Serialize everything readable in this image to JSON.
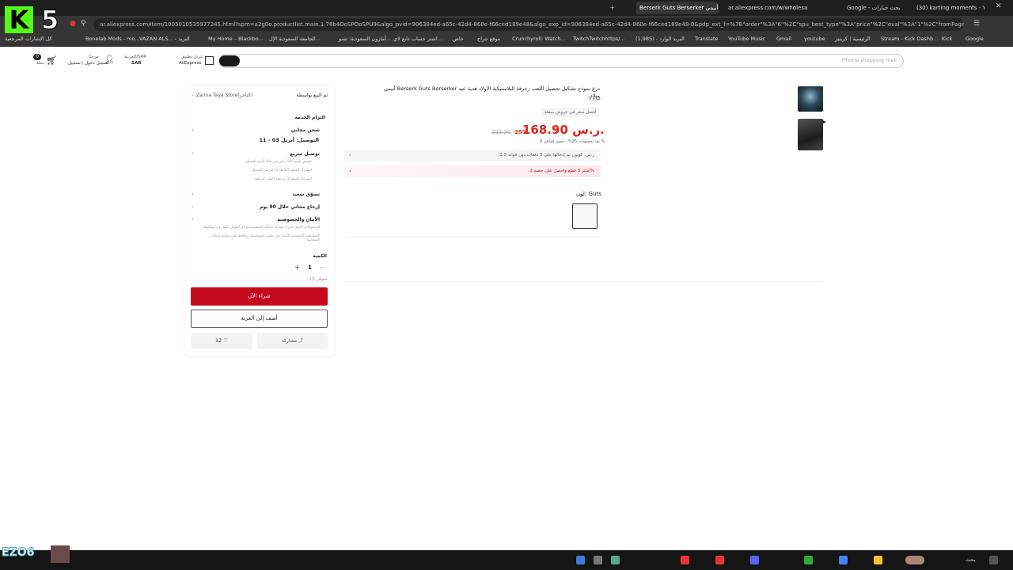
{
  "tabs": [
    {
      "label": "Berserk Guts Berserker أنيمي ...",
      "active": true
    },
    {
      "label": "ar.aliexpress.com/w/wholesale-",
      "active": false
    },
    {
      "label": "Google - بحث خيارات",
      "active": false
    },
    {
      "label": "(30) karting moments - YouTube",
      "active": false
    }
  ],
  "url": "ar.aliexpress.com/item/1005010535977245.html?spm=a2g0o.productlist.main.1.76b4OoSPOoSPU9&algo_pvid=906384ed-a65c-42d4-860e-f66ced189e48&algo_exp_id=906384ed-a65c-42d4-860e-f66ced189e48-0&pdp_ext_f=%7B\"order\"%3A\"6\"%2C\"spu_best_type\"%3A\"price\"%2C\"eval\"%3A\"1\"%2C\"fromPage\"%3A\"search\"%7D&pdp_npi=6%40",
  "bookmarks": [
    "كل الإشارات المرجعية",
    "Bonelab Mods - mo...",
    "VAZAN ALS... - البريد",
    "My Home – Blackbo...",
    "الجامعة السعودية الإل...",
    "أمازون السعودية: تسو...",
    "اشتر حساب دايغ لاي...",
    "خاص",
    "موقع جراح",
    "Crunchyroll: Watch...",
    "TwitchTwitchhttps/...",
    "(1,985) - البريد الوارد",
    "Translate",
    "YouTube Music",
    "Gmail",
    "youtube",
    "الرئيسية | كريتيز",
    "Stream - Kick Dashb...",
    "Kick",
    "Google"
  ],
  "header": {
    "cart_count": "0",
    "cart_label": "سلة",
    "account_hello": "مرحبًا",
    "account_label": "تسجيل دخول / تسجيل",
    "locale_top": "العربية/SAR",
    "locale_currency": "SAR",
    "app_label_top": "تنزيل تطبيق",
    "app_label_bottom": "AliExpress",
    "search_placeholder": "iPhone shopping mall"
  },
  "store": {
    "sold_by": "تم البيع بواسطة",
    "store_name": "Zanna Taya Store(التاجر)"
  },
  "shipping": {
    "commitment": "التزام الخدمة",
    "free_shipping": "شحن مجاني",
    "delivery": "التوصيل: أبريل 03 - 11",
    "fast_delivery": "توصيل سريع",
    "fast_line1": "تعويض قيمته 50 ر.س في حالة تأخير التسليم",
    "fast_line2": "استرداد المبلغ بالكامل إذا لم يتم التوصيل",
    "fast_line3": "استرداد المبلغ إذا تم فقد الطرد أو تلفه",
    "happy_shopping": "تسوّق سعيد",
    "free_returns": "إرجاع مجاني خلال 90 يوم",
    "security": "الأمان والخصوصية",
    "security_line1": "المدفوعات الآمنة: نحن لا نشارك بياناتك الشخصية مع أي أطراف ثالثة دون موافقتك",
    "security_line2": "المعلومات الشخصية الآمنة: نحن نحمي خصوصيتك ونحافظ على سلامة بياناتك الشخصية"
  },
  "quantity": {
    "label": "الكمية",
    "value": "1",
    "minus": "−",
    "plus": "+",
    "available": "متوفر 15"
  },
  "buttons": {
    "buy_now": "شراء الآن",
    "add_to_cart": "أضف إلى العربة",
    "share": "مشاركة",
    "wishlist_count": "12"
  },
  "product": {
    "title": "أنيمي Berserk Guts Berserker درع نموذج تشكيل تحصيل اللعب زخرفة البلاستيكية الأولاد هدية عيد ميلاد",
    "sold": "5 مُباع",
    "badge": "أفضل سعر في عروض سفلة",
    "price": "168.90 ر.س.",
    "discount": "25%",
    "old_price": "225.20",
    "tax_note": "بعد تخفيضات 25% - حسم إضافي 0 %",
    "promo1": "2.3 ر.س. كوبون تم إدخالها على 5 دفعات دون فوائد",
    "promo2": "إشتر 3 قطع واحصل على خصم 2%",
    "color_label": "لون: Guts"
  },
  "thumbnails": [
    "thumb-1",
    "thumb-2"
  ],
  "stream": {
    "logo_letter": "K",
    "number": "5",
    "overlay_name": "EZO6"
  },
  "taskbar": {
    "search_label": "بحث"
  },
  "colors": {
    "accent_red": "#c4081c",
    "price_red": "#e1251b",
    "kick_green": "#53fc18"
  }
}
